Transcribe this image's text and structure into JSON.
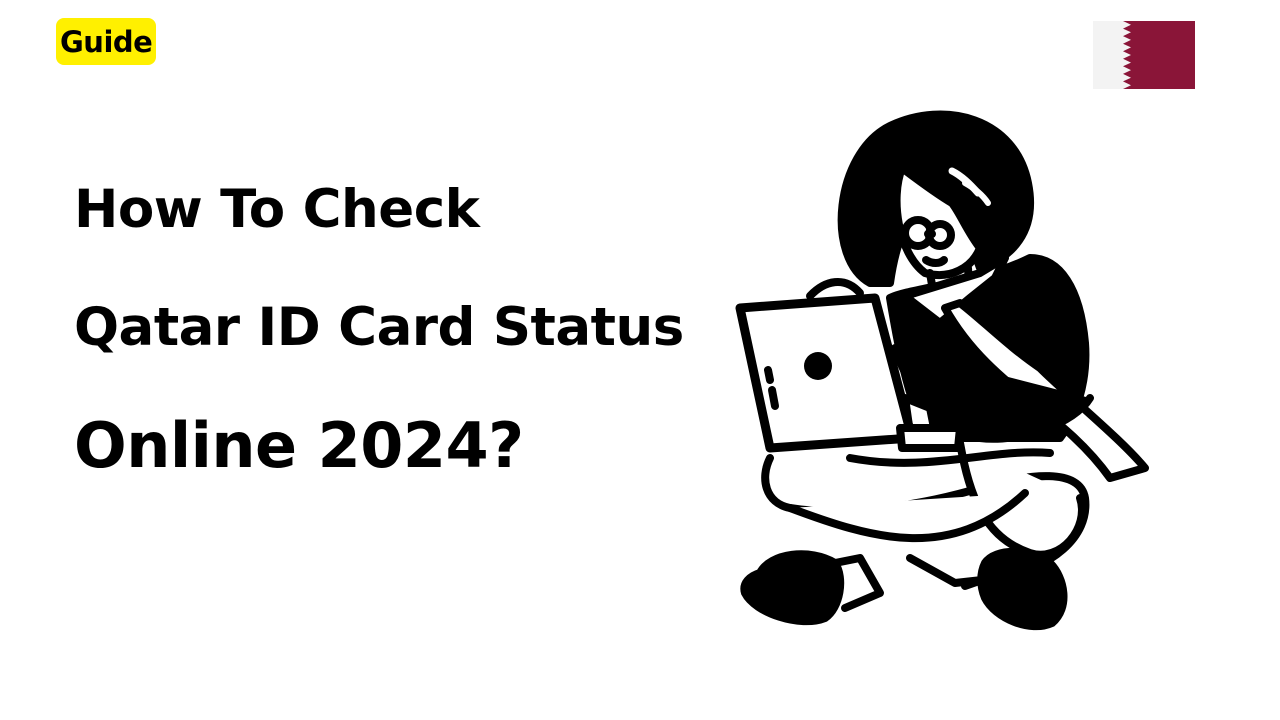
{
  "badge": {
    "label": "Guide",
    "color": "#fff000"
  },
  "headline": {
    "line1": "How To Check",
    "line2": "Qatar ID Card Status",
    "line3": "Online 2024?"
  },
  "flag": {
    "icon": "qatar-flag-icon",
    "colors": {
      "white": "#f3f3f3",
      "maroon": "#8a1538"
    }
  },
  "illustration": {
    "icon": "person-with-laptop-icon"
  }
}
